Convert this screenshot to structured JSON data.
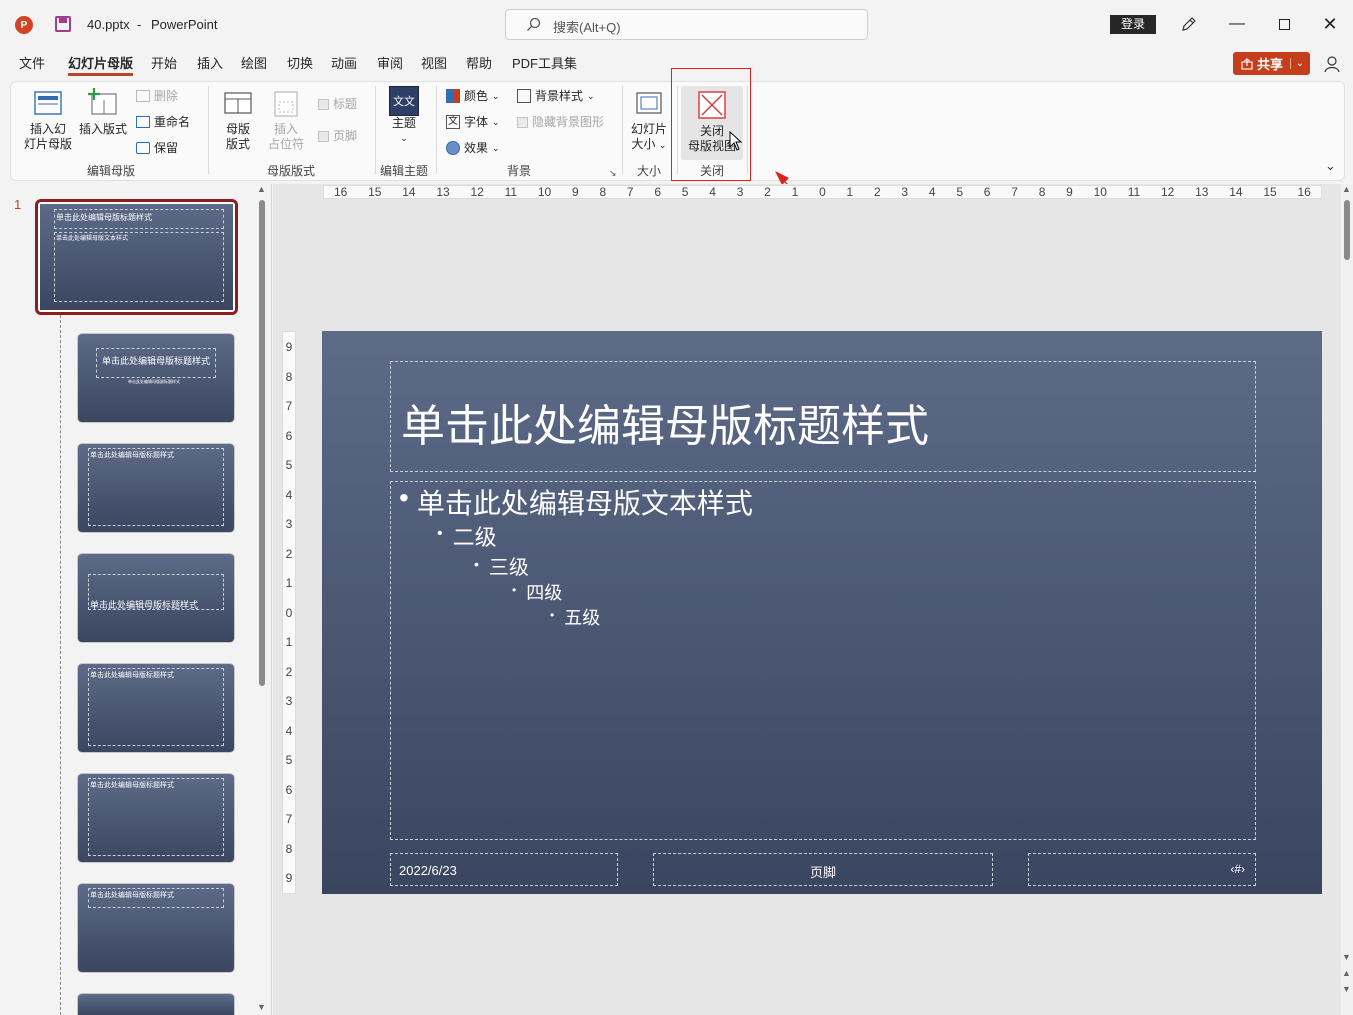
{
  "titlebar": {
    "filename": "40.pptx",
    "separator": "-",
    "app_name": "PowerPoint",
    "search_placeholder": "搜索(Alt+Q)",
    "login_label": "登录"
  },
  "tabs": [
    {
      "label": "文件"
    },
    {
      "label": "幻灯片母版",
      "active": true
    },
    {
      "label": "开始"
    },
    {
      "label": "插入"
    },
    {
      "label": "绘图"
    },
    {
      "label": "切换"
    },
    {
      "label": "动画"
    },
    {
      "label": "审阅"
    },
    {
      "label": "视图"
    },
    {
      "label": "帮助"
    },
    {
      "label": "PDF工具集"
    }
  ],
  "share_label": "共享",
  "ribbon": {
    "insert_master_l1": "插入幻",
    "insert_master_l2": "灯片母版",
    "insert_layout": "插入版式",
    "delete": "删除",
    "rename": "重命名",
    "preserve": "保留",
    "group_edit_master": "编辑母版",
    "master_layout_l1": "母版",
    "master_layout_l2": "版式",
    "insert_ph_l1": "插入",
    "insert_ph_l2": "占位符",
    "title_cb": "标题",
    "footer_cb": "页脚",
    "group_master_layout": "母版版式",
    "themes": "主题",
    "group_edit_theme": "编辑主题",
    "colors": "颜色",
    "fonts": "字体",
    "effects": "效果",
    "bg_styles": "背景样式",
    "hide_bg": "隐藏背景图形",
    "group_background": "背景",
    "slide_size_l1": "幻灯片",
    "slide_size_l2": "大小",
    "group_size": "大小",
    "close_l1": "关闭",
    "close_l2": "母版视图",
    "group_close": "关闭"
  },
  "ruler": {
    "h_ticks": [
      "16",
      "15",
      "14",
      "13",
      "12",
      "11",
      "10",
      "9",
      "8",
      "7",
      "6",
      "5",
      "4",
      "3",
      "2",
      "1",
      "0",
      "1",
      "2",
      "3",
      "4",
      "5",
      "6",
      "7",
      "8",
      "9",
      "10",
      "11",
      "12",
      "13",
      "14",
      "15",
      "16"
    ],
    "v_ticks": [
      "9",
      "8",
      "7",
      "6",
      "5",
      "4",
      "3",
      "2",
      "1",
      "0",
      "1",
      "2",
      "3",
      "4",
      "5",
      "6",
      "7",
      "8",
      "9"
    ]
  },
  "thumbnails": {
    "master_number": "1",
    "master_title": "单击此处编辑母版标题样式",
    "master_body": "单击此处编辑母版文本样式",
    "layout2_title": "单击此处编辑母版标题样式",
    "layout2_sub": "单击此处编辑母版副标题样式",
    "layout3_title": "单击此处编辑母版标题样式",
    "layout4_title": "单击此处编辑母版标题样式",
    "layout5_title": "单击此处编辑母版标题样式",
    "layout6_title": "单击此处编辑母版标题样式",
    "layout7_title": "单击此处编辑母版标题样式"
  },
  "slide": {
    "title": "单击此处编辑母版标题样式",
    "level1": "单击此处编辑母版文本样式",
    "level2": "二级",
    "level3": "三级",
    "level4": "四级",
    "level5": "五级",
    "date": "2022/6/23",
    "footer": "页脚",
    "slide_number": "‹#›"
  },
  "colors": {
    "accent": "#b7472a",
    "annotation": "#e0201c",
    "slide_top": "#5d6b88",
    "slide_bottom": "#3a4560"
  }
}
